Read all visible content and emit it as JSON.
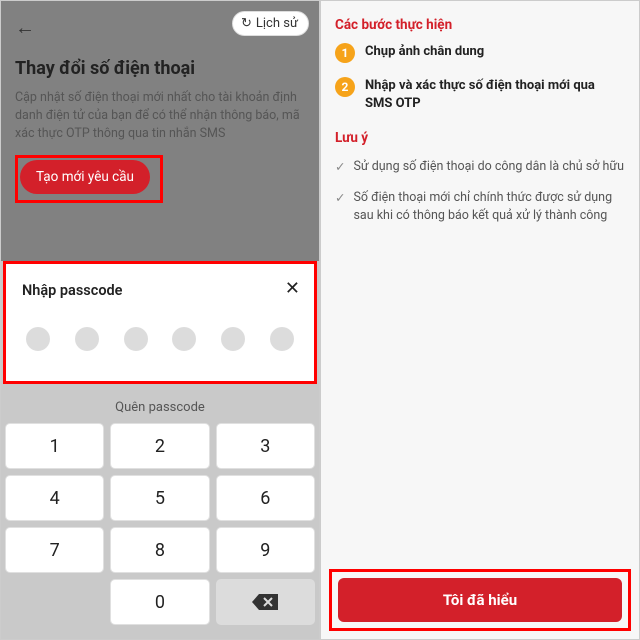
{
  "left": {
    "history_label": "Lịch sử",
    "title": "Thay đổi số điện thoại",
    "description": "Cập nhật số điện thoại mới nhất cho tài khoản định danh điện tử của bạn để có thể nhận thông báo, mã xác thực OTP thông qua tin nhắn SMS",
    "create_btn": "Tạo mới yêu cầu",
    "passcode_title": "Nhập passcode",
    "forgot": "Quên passcode",
    "keys": {
      "k1": "1",
      "k2": "2",
      "k3": "3",
      "k4": "4",
      "k5": "5",
      "k6": "6",
      "k7": "7",
      "k8": "8",
      "k9": "9",
      "k0": "0"
    }
  },
  "right": {
    "steps_heading": "Các bước thực hiện",
    "step1_num": "1",
    "step1_text": "Chụp ảnh chân dung",
    "step2_num": "2",
    "step2_text": "Nhập và xác thực số điện thoại mới qua SMS OTP",
    "notes_heading": "Lưu ý",
    "note1": "Sử dụng số điện thoại do công dân là chủ sở hữu",
    "note2": "Số điện thoại mới chỉ chính thức được sử dụng sau khi có thông báo kết quả xử lý thành công",
    "cta": "Tôi đã hiểu"
  }
}
